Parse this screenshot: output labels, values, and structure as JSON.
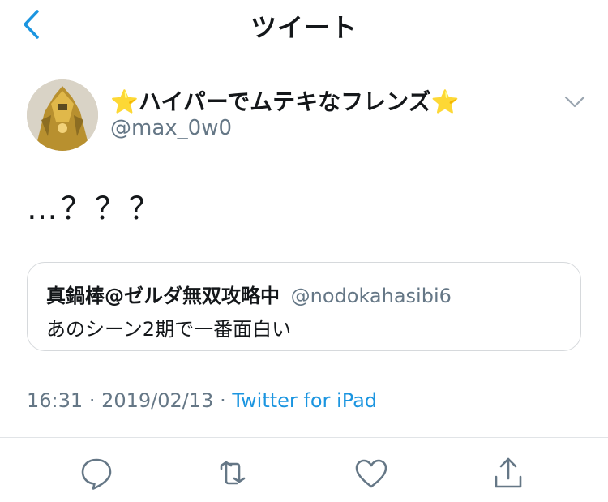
{
  "nav": {
    "title": "ツイート",
    "back_icon": "chevron-left-icon",
    "accent": "#1b95e0"
  },
  "tweet": {
    "display_name": "⭐️ハイパーでムテキなフレンズ⭐️",
    "username": "@max_0w0",
    "text": "…？？？",
    "menu_icon": "chevron-down-icon"
  },
  "quote": {
    "name": "真鍋棒@ゼルダ無双攻略中",
    "username": "@nodokahasibi6",
    "text": "あのシーン2期で一番面白い"
  },
  "meta": {
    "time": "16:31",
    "separator": "·",
    "date": "2019/02/13",
    "source": "Twitter for iPad"
  },
  "actions": [
    "reply-icon",
    "retweet-icon",
    "like-icon",
    "share-icon"
  ],
  "colors": {
    "text": "#14171a",
    "secondary": "#657786",
    "link": "#1b95e0",
    "border": "#d6d9dc"
  }
}
